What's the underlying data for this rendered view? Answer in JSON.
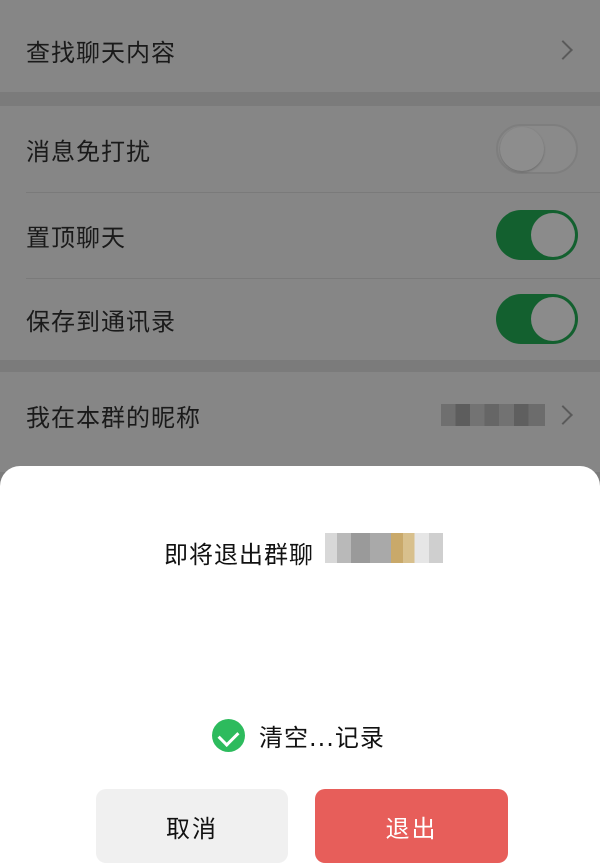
{
  "settings": {
    "search_chat": {
      "label": "查找聊天内容"
    },
    "mute": {
      "label": "消息免打扰",
      "enabled": false
    },
    "pin": {
      "label": "置顶聊天",
      "enabled": true
    },
    "save_contacts": {
      "label": "保存到通讯录",
      "enabled": true
    },
    "nickname": {
      "label": "我在本群的昵称"
    }
  },
  "dialog": {
    "title": "即将退出群聊",
    "clear_history_label": "清空...记录",
    "clear_history_checked": true,
    "cancel_label": "取消",
    "exit_label": "退出"
  },
  "colors": {
    "accent_green": "#2dbb5d",
    "danger_red": "#e75e5a"
  }
}
